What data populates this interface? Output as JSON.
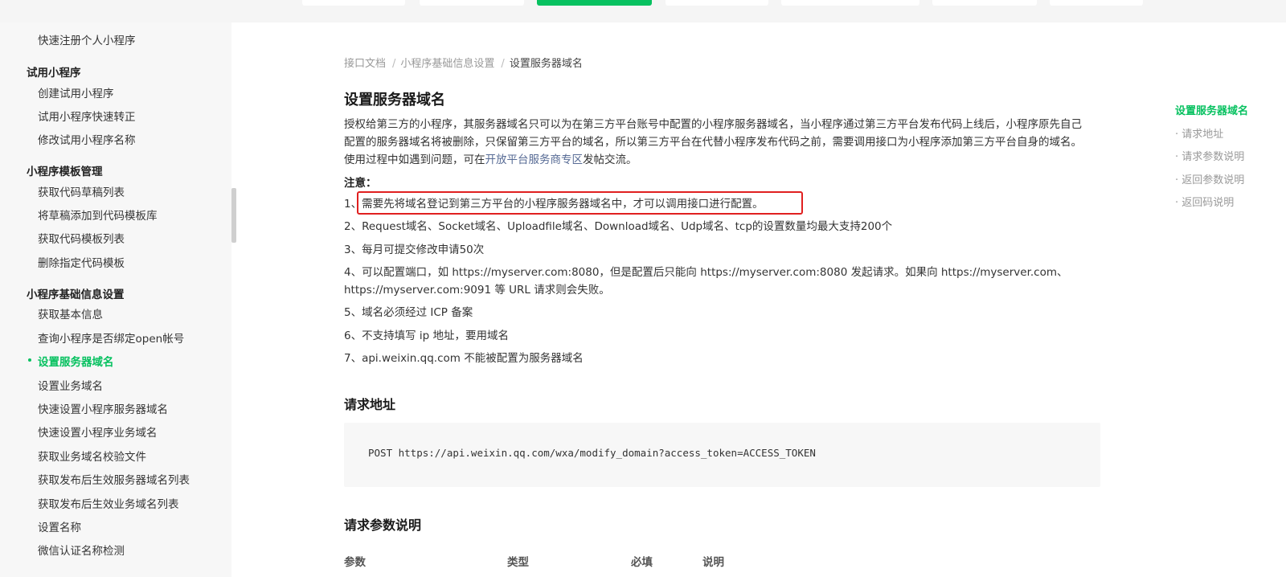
{
  "sidebar": {
    "items": [
      {
        "type": "item",
        "label": "快速注册个人小程序"
      },
      {
        "type": "group",
        "label": "试用小程序"
      },
      {
        "type": "item",
        "label": "创建试用小程序"
      },
      {
        "type": "item",
        "label": "试用小程序快速转正"
      },
      {
        "type": "item",
        "label": "修改试用小程序名称"
      },
      {
        "type": "group",
        "label": "小程序模板管理"
      },
      {
        "type": "item",
        "label": "获取代码草稿列表"
      },
      {
        "type": "item",
        "label": "将草稿添加到代码模板库"
      },
      {
        "type": "item",
        "label": "获取代码模板列表"
      },
      {
        "type": "item",
        "label": "删除指定代码模板"
      },
      {
        "type": "group",
        "label": "小程序基础信息设置"
      },
      {
        "type": "item",
        "label": "获取基本信息"
      },
      {
        "type": "item",
        "label": "查询小程序是否绑定open帐号"
      },
      {
        "type": "item",
        "label": "设置服务器域名",
        "active": true
      },
      {
        "type": "item",
        "label": "设置业务域名"
      },
      {
        "type": "item",
        "label": "快速设置小程序服务器域名"
      },
      {
        "type": "item",
        "label": "快速设置小程序业务域名"
      },
      {
        "type": "item",
        "label": "获取业务域名校验文件"
      },
      {
        "type": "item",
        "label": "获取发布后生效服务器域名列表"
      },
      {
        "type": "item",
        "label": "获取发布后生效业务域名列表"
      },
      {
        "type": "item",
        "label": "设置名称"
      },
      {
        "type": "item",
        "label": "微信认证名称检测"
      }
    ]
  },
  "breadcrumb": {
    "items": [
      "接口文档",
      "小程序基础信息设置"
    ],
    "separator": "/",
    "current": "设置服务器域名"
  },
  "content": {
    "title": "设置服务器域名",
    "intro_line1": "授权给第三方的小程序，其服务器域名只可以为在第三方平台账号中配置的小程序服务器域名，当小程序通过第三方平台发布代码上线后，小程序原先自己",
    "intro_line2": "配置的服务器域名将被删除，只保留第三方平台的域名，所以第三方平台在代替小程序发布代码之前，需要调用接口为小程序添加第三方平台自身的域名。",
    "intro_line3_pre": "使用过程中如遇到问题，可在",
    "intro_link": "开放平台服务商专区",
    "intro_line3_post": "发帖交流。",
    "note_title": "注意：",
    "notes": [
      "1、需要先将域名登记到第三方平台的小程序服务器域名中，才可以调用接口进行配置。",
      "2、Request域名、Socket域名、Uploadfile域名、Download域名、Udp域名、tcp的设置数量均最大支持200个",
      "3、每月可提交修改申请50次",
      "4、可以配置端口，如 https://myserver.com:8080，但是配置后只能向 https://myserver.com:8080 发起请求。如果向 https://myserver.com、",
      "https://myserver.com:9091 等 URL 请求则会失败。",
      "5、域名必须经过 ICP 备案",
      "6、不支持填写 ip 地址，要用域名",
      "7、api.weixin.qq.com 不能被配置为服务器域名"
    ],
    "request_title": "请求地址",
    "request_code": "POST https://api.weixin.qq.com/wxa/modify_domain?access_token=ACCESS_TOKEN",
    "params_title": "请求参数说明",
    "params_headers": [
      "参数",
      "类型",
      "必填",
      "说明"
    ]
  },
  "toc": {
    "items": [
      {
        "label": "设置服务器域名",
        "active": true
      },
      {
        "label": "· 请求地址"
      },
      {
        "label": "· 请求参数说明"
      },
      {
        "label": "· 返回参数说明"
      },
      {
        "label": "· 返回码说明"
      }
    ]
  },
  "colors": {
    "accent": "#07c160",
    "link": "#576b95",
    "highlight_border": "#e02020",
    "sidebar_bg": "#f7f7f7"
  }
}
